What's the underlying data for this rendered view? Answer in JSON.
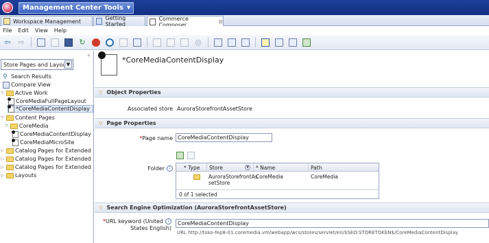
{
  "title_bar": {
    "menu_label": "Management Center Tools"
  },
  "tabs": [
    {
      "label": "Workspace Management"
    },
    {
      "label": "Getting Started"
    },
    {
      "label": "Commerce Composer"
    }
  ],
  "menu": [
    "File",
    "Edit",
    "View",
    "Help"
  ],
  "toolbar_icons": [
    "back-icon",
    "forward-icon",
    "new-icon",
    "open-icon",
    "save-icon",
    "refresh-icon",
    "stop-icon",
    "find-icon",
    "copy-icon",
    "paste-icon",
    "preview-icon",
    "calendar-icon",
    "compare-icon",
    "duplicate-icon",
    "binoculars-icon",
    "layout-icon",
    "columns-icon",
    "grid-icon",
    "panel-icon",
    "split-icon",
    "window-icon",
    "tile-icon"
  ],
  "left_panel": {
    "selector_value": "Store Pages and Layouts",
    "tree": [
      {
        "label": "Search Results"
      },
      {
        "label": "Compare View"
      },
      {
        "label": "Active Work"
      },
      {
        "label": "CoreMediaFullPageLayout"
      },
      {
        "label": "*CoreMediaContentDisplay"
      },
      {
        "label": "Content Pages"
      },
      {
        "label": "CoreMedia"
      },
      {
        "label": "CoreMediaContentDisplay"
      },
      {
        "label": "CoreMediaMicroSite"
      },
      {
        "label": "Catalog Pages for Extended S"
      },
      {
        "label": "Catalog Pages for Extended S"
      },
      {
        "label": "Catalog Pages for Extended S"
      },
      {
        "label": "Layouts"
      }
    ]
  },
  "header": {
    "title": "*CoreMediaContentDisplay"
  },
  "object_properties": {
    "section_title": "Object Properties",
    "store_label": "Associated store",
    "store_value": "AuroraStorefrontAssetStore"
  },
  "page_properties": {
    "section_title": "Page Properties",
    "page_name_label": "Page name",
    "page_name_value": "CoreMediaContentDisplay",
    "folder_label": "Folder",
    "table": {
      "headers": [
        "* Type",
        "Store",
        "* Name",
        "Path"
      ],
      "row": {
        "store": "AuroraStorefrontAssetStore",
        "store_line1": "AuroraStorefrontAs",
        "store_line2": "setStore",
        "name": "CoreMedia",
        "path": "CoreMedia"
      },
      "footer": "0 of 1 selected"
    }
  },
  "seo": {
    "section_title": "Search Engine Optimization (AuroraStorefrontAssetStore)",
    "url_keyword_label_line1": "URL keyword (United",
    "url_keyword_label_line2": "States English)",
    "url_keyword_value": "CoreMediaContentDisplay",
    "url_text": "URL http://toko-fep8-01.coremedia.vm/webapp/wcs/stores/servlet/en/$SEO:STORETOKEN$/CoreMediaContentDisplay"
  }
}
